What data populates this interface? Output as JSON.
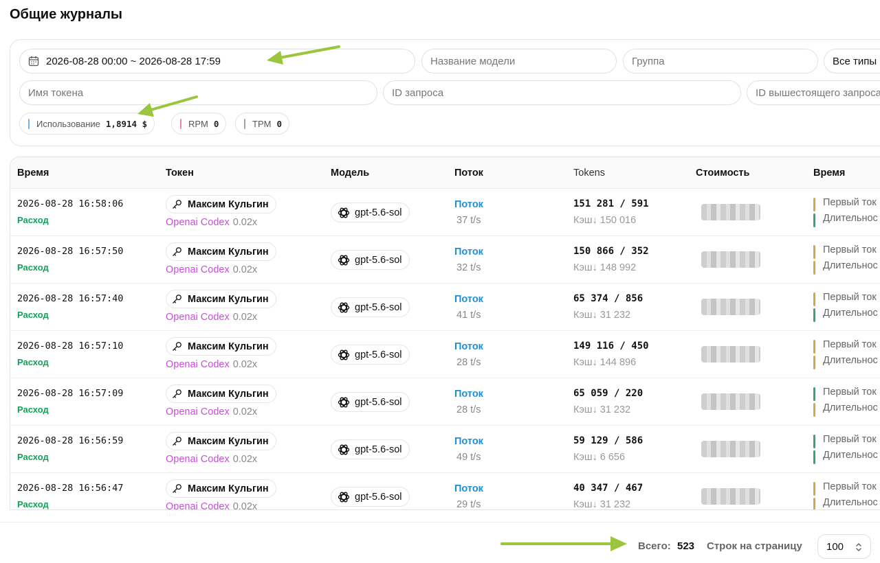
{
  "page": {
    "title": "Общие журналы"
  },
  "filters": {
    "date_range": "2026-08-28 00:00 ~ 2026-08-28 17:59",
    "model_placeholder": "Название модели",
    "group_placeholder": "Группа",
    "type_select": "Все типы",
    "token_placeholder": "Имя токена",
    "request_id_placeholder": "ID запроса",
    "upstream_id_placeholder": "ID вышестоящего запроса"
  },
  "stats": [
    {
      "label": "Использование",
      "value": "1,8914 $",
      "color": "#6fb3ef"
    },
    {
      "label": "RPM",
      "value": "0",
      "color": "#e88aa6"
    },
    {
      "label": "TPM",
      "value": "0",
      "color": "#9aa7b3"
    }
  ],
  "table": {
    "columns": [
      "Время",
      "Токен",
      "Модель",
      "Поток",
      "Tokens",
      "Стоимость",
      "Время"
    ],
    "rows": [
      {
        "time": "2026-08-28 16:58:06",
        "type": "Расход",
        "token": "Максим Кульгин",
        "group": "Openai Codex",
        "ratio": "0.02x",
        "model": "gpt-5.6-sol",
        "stream": "Поток",
        "speed": "37 t/s",
        "tokens": "151 281 / 591",
        "cache": "Кэш↓ 150 016",
        "first_color": "#d9a54a",
        "duration_color": "#3aa574"
      },
      {
        "time": "2026-08-28 16:57:50",
        "type": "Расход",
        "token": "Максим Кульгин",
        "group": "Openai Codex",
        "ratio": "0.02x",
        "model": "gpt-5.6-sol",
        "stream": "Поток",
        "speed": "32 t/s",
        "tokens": "150 866 / 352",
        "cache": "Кэш↓ 148 992",
        "first_color": "#d9a54a",
        "duration_color": "#d9a54a"
      },
      {
        "time": "2026-08-28 16:57:40",
        "type": "Расход",
        "token": "Максим Кульгин",
        "group": "Openai Codex",
        "ratio": "0.02x",
        "model": "gpt-5.6-sol",
        "stream": "Поток",
        "speed": "41 t/s",
        "tokens": "65 374 / 856",
        "cache": "Кэш↓ 31 232",
        "first_color": "#d9a54a",
        "duration_color": "#3aa574"
      },
      {
        "time": "2026-08-28 16:57:10",
        "type": "Расход",
        "token": "Максим Кульгин",
        "group": "Openai Codex",
        "ratio": "0.02x",
        "model": "gpt-5.6-sol",
        "stream": "Поток",
        "speed": "28 t/s",
        "tokens": "149 116 / 450",
        "cache": "Кэш↓ 144 896",
        "first_color": "#d9a54a",
        "duration_color": "#d9a54a"
      },
      {
        "time": "2026-08-28 16:57:09",
        "type": "Расход",
        "token": "Максим Кульгин",
        "group": "Openai Codex",
        "ratio": "0.02x",
        "model": "gpt-5.6-sol",
        "stream": "Поток",
        "speed": "28 t/s",
        "tokens": "65 059 / 220",
        "cache": "Кэш↓ 31 232",
        "first_color": "#3aa574",
        "duration_color": "#d9a54a"
      },
      {
        "time": "2026-08-28 16:56:59",
        "type": "Расход",
        "token": "Максим Кульгин",
        "group": "Openai Codex",
        "ratio": "0.02x",
        "model": "gpt-5.6-sol",
        "stream": "Поток",
        "speed": "49 t/s",
        "tokens": "59 129 / 586",
        "cache": "Кэш↓ 6 656",
        "first_color": "#3aa574",
        "duration_color": "#3aa574"
      },
      {
        "time": "2026-08-28 16:56:47",
        "type": "Расход",
        "token": "Максим Кульгин",
        "group": "Openai Codex",
        "ratio": "0.02x",
        "model": "gpt-5.6-sol",
        "stream": "Поток",
        "speed": "29 t/s",
        "tokens": "40 347 / 467",
        "cache": "Кэш↓ 31 232",
        "first_color": "#d9a54a",
        "duration_color": "#d9a54a"
      }
    ],
    "timing_labels": {
      "first": "Первый ток",
      "duration": "Длительнос"
    }
  },
  "footer": {
    "total_label": "Всего:",
    "total_value": "523",
    "rows_per_page_label": "Строк на страницу",
    "rows_per_page_value": "100"
  },
  "icons": {
    "calendar": "calendar-icon",
    "key": "key-icon",
    "model": "openai-logo-icon",
    "select": "chevron-updown-icon"
  },
  "annotation_color": "#9bc53d"
}
